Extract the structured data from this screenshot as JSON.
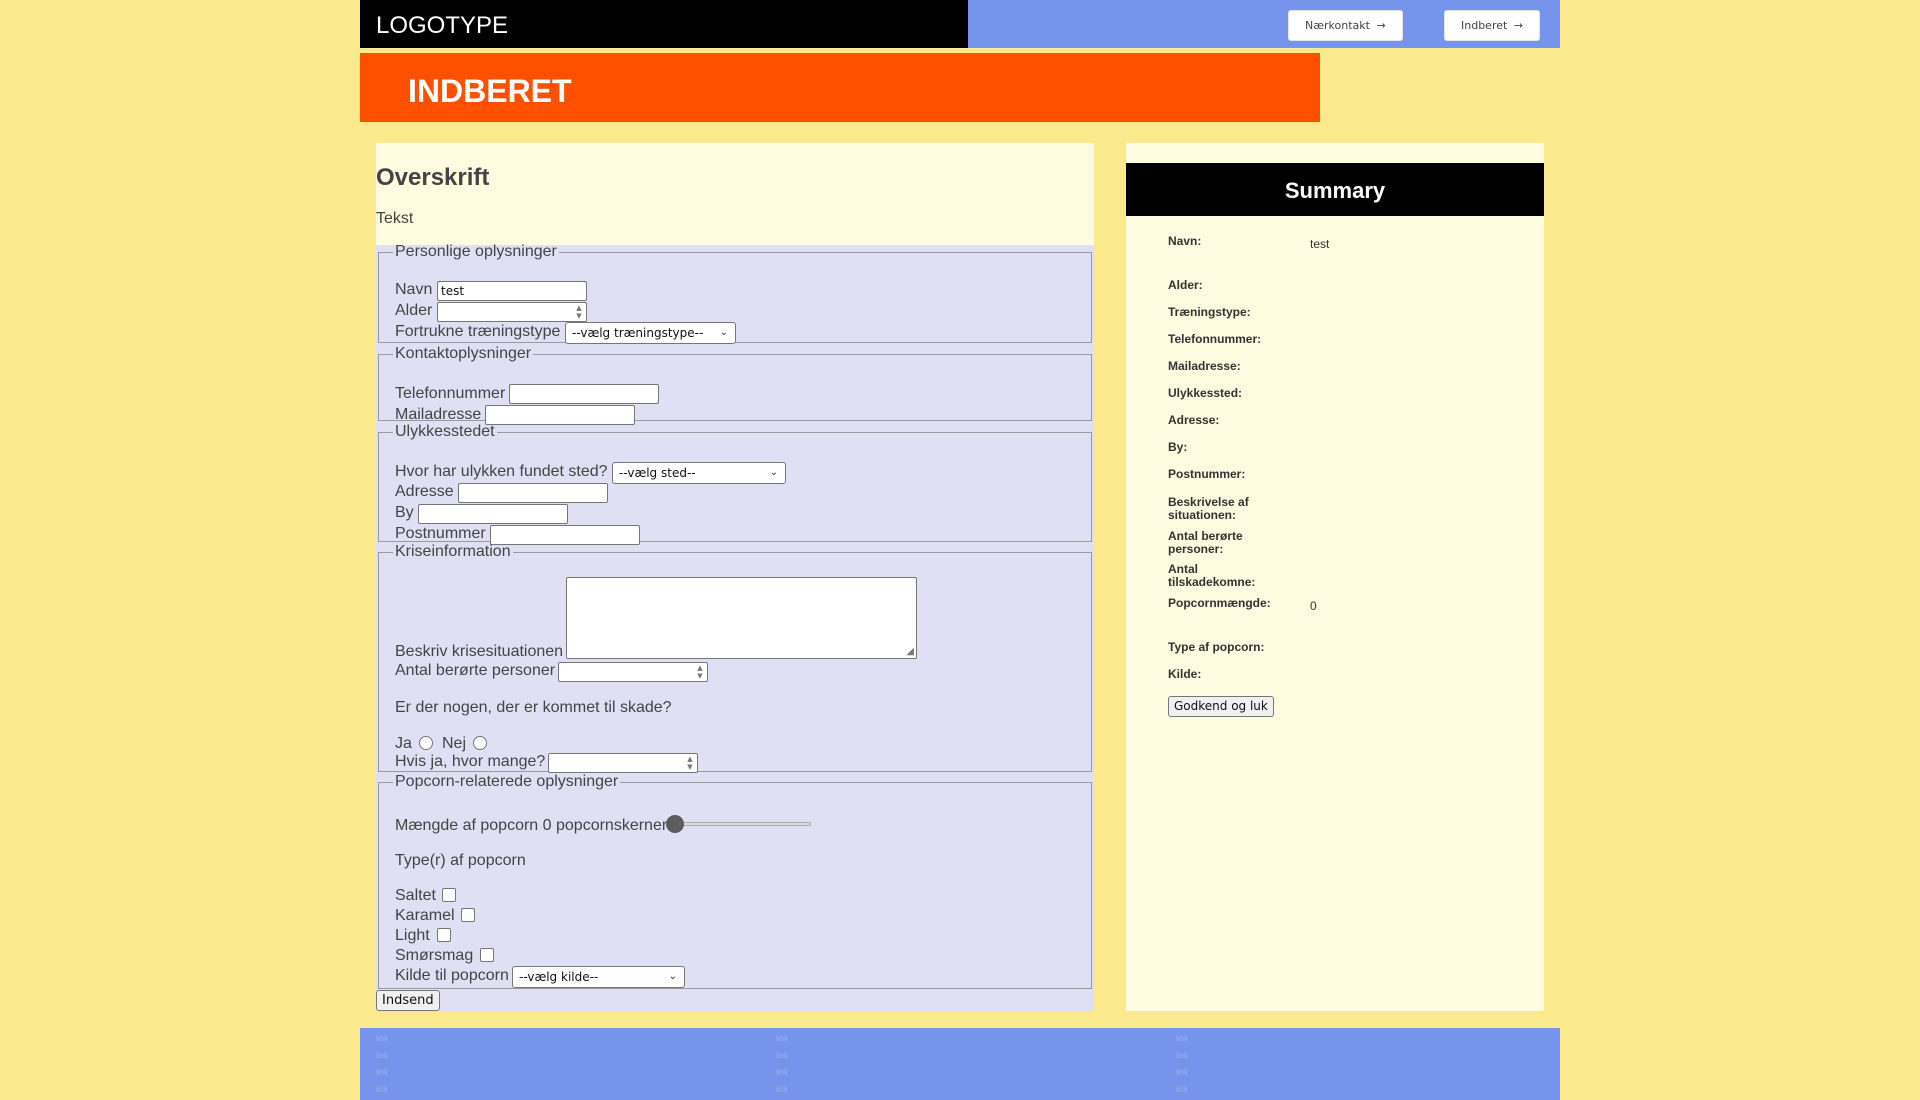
{
  "header": {
    "logo": "LOGOTYPE",
    "nav": [
      {
        "label": "Nærkontakt",
        "arrow": "→"
      },
      {
        "label": "Indberet",
        "arrow": "→"
      }
    ]
  },
  "banner": {
    "title": "INDBERET"
  },
  "intro": {
    "heading": "Overskrift",
    "text": "Tekst"
  },
  "form": {
    "personal": {
      "legend": "Personlige oplysninger",
      "name_label": "Navn",
      "name_value": "test",
      "age_label": "Alder",
      "age_value": "",
      "training_label": "Fortrukne træningstype",
      "training_selected": "--vælg træningstype--"
    },
    "contact": {
      "legend": "Kontaktoplysninger",
      "phone_label": "Telefonnummer",
      "phone_value": "",
      "email_label": "Mailadresse",
      "email_value": ""
    },
    "location": {
      "legend": "Ulykkesstedet",
      "where_label": "Hvor har ulykken fundet sted?",
      "where_selected": "--vælg sted--",
      "address_label": "Adresse",
      "address_value": "",
      "city_label": "By",
      "city_value": "",
      "zip_label": "Postnummer",
      "zip_value": ""
    },
    "crisis": {
      "legend": "Kriseinformation",
      "describe_label": "Beskriv krisesituationen",
      "affected_label": "Antal berørte personer",
      "injured_question": "Er der nogen, der er kommet til skade?",
      "yes_label": "Ja",
      "no_label": "Nej",
      "how_many_label": "Hvis ja, hvor mange?"
    },
    "popcorn": {
      "legend": "Popcorn-relaterede oplysninger",
      "amount_label": "Mængde af popcorn 0 popcornskerner",
      "amount_value": 0,
      "types_label": "Type(r) af popcorn",
      "types": [
        "Saltet",
        "Karamel",
        "Light",
        "Smørsmag"
      ],
      "source_label": "Kilde til popcorn",
      "source_selected": "--vælg kilde--"
    },
    "submit_label": "Indsend"
  },
  "summary": {
    "title": "Summary",
    "rows": [
      {
        "label": "Navn:",
        "value": "test"
      },
      {
        "label": "Alder:",
        "value": ""
      },
      {
        "label": "Træningstype:",
        "value": ""
      },
      {
        "label": "Telefonnummer:",
        "value": ""
      },
      {
        "label": "Mailadresse:",
        "value": ""
      },
      {
        "label": "Ulykkessted:",
        "value": ""
      },
      {
        "label": "Adresse:",
        "value": ""
      },
      {
        "label": "By:",
        "value": ""
      },
      {
        "label": "Postnummer:",
        "value": ""
      },
      {
        "label": "Beskrivelse af situationen:",
        "value": ""
      },
      {
        "label": "Antal berørte personer:",
        "value": ""
      },
      {
        "label": "Antal tilskadekomne:",
        "value": ""
      },
      {
        "label": "Popcornmængde:",
        "value": "0"
      },
      {
        "label": "Type af popcorn:",
        "value": ""
      },
      {
        "label": "Kilde:",
        "value": ""
      }
    ],
    "approve_label": "Godkend og luk"
  },
  "footer": {
    "columns": [
      [
        "link",
        "link",
        "link",
        "link"
      ],
      [
        "link",
        "link",
        "link",
        "link"
      ],
      [
        "link",
        "link",
        "link",
        "link"
      ]
    ]
  },
  "colors": {
    "page_bg": "#fbe98e",
    "topbar": "#7694ec",
    "banner": "#ff5000",
    "form_bg": "#dfe0f3",
    "panel_bg": "#fefbe0"
  }
}
